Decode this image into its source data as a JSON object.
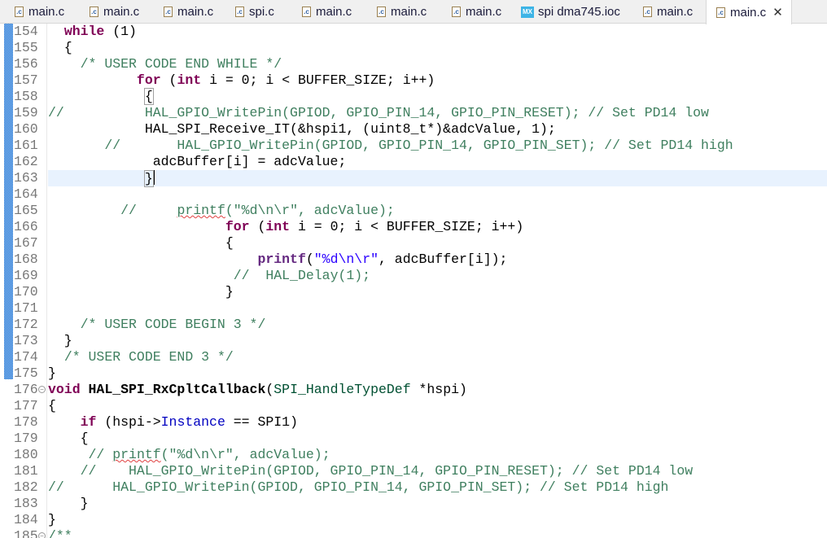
{
  "tabs": [
    {
      "label": "main.c",
      "icon": "c-file-icon"
    },
    {
      "label": "main.c",
      "icon": "c-file-icon"
    },
    {
      "label": "main.c",
      "icon": "c-file-icon"
    },
    {
      "label": "spi.c",
      "icon": "c-file-icon"
    },
    {
      "label": "main.c",
      "icon": "c-file-icon"
    },
    {
      "label": "main.c",
      "icon": "c-file-icon"
    },
    {
      "label": "main.c",
      "icon": "c-file-icon"
    },
    {
      "label": "spi dma745.ioc",
      "icon": "mx-icon"
    },
    {
      "label": "main.c",
      "icon": "c-file-icon"
    },
    {
      "label": "main.c",
      "icon": "c-file-icon",
      "active": true
    }
  ],
  "icons": {
    "c_file": ".c",
    "mx": "MX",
    "close": "✕",
    "fold": "−"
  },
  "code": {
    "current_line": 163,
    "lines": [
      {
        "n": "154",
        "segs": [
          [
            "p",
            "  "
          ],
          [
            "k",
            "while"
          ],
          [
            "p",
            " (1)"
          ]
        ]
      },
      {
        "n": "155",
        "segs": [
          [
            "p",
            "  {"
          ]
        ]
      },
      {
        "n": "156",
        "segs": [
          [
            "p",
            "    "
          ],
          [
            "c",
            "/* USER CODE END WHILE */"
          ]
        ]
      },
      {
        "n": "157",
        "segs": [
          [
            "p",
            "           "
          ],
          [
            "k",
            "for"
          ],
          [
            "p",
            " ("
          ],
          [
            "k",
            "int"
          ],
          [
            "p",
            " i = 0; i < BUFFER_SIZE; i++)"
          ]
        ]
      },
      {
        "n": "158",
        "segs": [
          [
            "p",
            "            "
          ],
          [
            "br",
            "{"
          ]
        ]
      },
      {
        "n": "159",
        "segs": [
          [
            "c",
            "//          HAL_GPIO_WritePin(GPIOD, GPIO_PIN_14, GPIO_PIN_RESET); // Set PD14 low"
          ]
        ]
      },
      {
        "n": "160",
        "segs": [
          [
            "p",
            "            HAL_SPI_Receive_IT(&hspi1, (uint8_t*)&adcValue, 1);"
          ]
        ]
      },
      {
        "n": "161",
        "segs": [
          [
            "p",
            "       "
          ],
          [
            "c",
            "//       HAL_GPIO_WritePin(GPIOD, GPIO_PIN_14, GPIO_PIN_SET); // Set PD14 high"
          ]
        ]
      },
      {
        "n": "162",
        "segs": [
          [
            "p",
            "             adcBuffer[i] = adcValue;"
          ]
        ]
      },
      {
        "n": "163",
        "segs": [
          [
            "p",
            "            "
          ],
          [
            "br",
            "}"
          ],
          [
            "caret",
            ""
          ]
        ]
      },
      {
        "n": "164",
        "segs": []
      },
      {
        "n": "165",
        "segs": [
          [
            "p",
            "         "
          ],
          [
            "c",
            "//     "
          ],
          [
            "csq",
            "printf"
          ],
          [
            "c",
            "(\"%d\\n\\r\", adcValue);"
          ]
        ]
      },
      {
        "n": "166",
        "segs": [
          [
            "p",
            "                      "
          ],
          [
            "k",
            "for"
          ],
          [
            "p",
            " ("
          ],
          [
            "k",
            "int"
          ],
          [
            "p",
            " i = 0; i < BUFFER_SIZE; i++)"
          ]
        ]
      },
      {
        "n": "167",
        "segs": [
          [
            "p",
            "                      {"
          ]
        ]
      },
      {
        "n": "168",
        "segs": [
          [
            "p",
            "                          "
          ],
          [
            "m",
            "printf"
          ],
          [
            "p",
            "("
          ],
          [
            "s",
            "\"%d\\n\\r\""
          ],
          [
            "p",
            ", adcBuffer[i]);"
          ]
        ]
      },
      {
        "n": "169",
        "segs": [
          [
            "p",
            "                       "
          ],
          [
            "c",
            "//  HAL_Delay(1);"
          ]
        ]
      },
      {
        "n": "170",
        "segs": [
          [
            "p",
            "                      }"
          ]
        ]
      },
      {
        "n": "171",
        "segs": []
      },
      {
        "n": "172",
        "segs": [
          [
            "p",
            "    "
          ],
          [
            "c",
            "/* USER CODE BEGIN 3 */"
          ]
        ]
      },
      {
        "n": "173",
        "segs": [
          [
            "p",
            "  }"
          ]
        ]
      },
      {
        "n": "174",
        "segs": [
          [
            "p",
            "  "
          ],
          [
            "c",
            "/* USER CODE END 3 */"
          ]
        ]
      },
      {
        "n": "175",
        "segs": [
          [
            "p",
            "}"
          ]
        ]
      },
      {
        "n": "176",
        "fold": true,
        "segs": [
          [
            "k",
            "void"
          ],
          [
            "p",
            " "
          ],
          [
            "f",
            "HAL_SPI_RxCpltCallback"
          ],
          [
            "p",
            "("
          ],
          [
            "t",
            "SPI_HandleTypeDef"
          ],
          [
            "p",
            " *hspi)"
          ]
        ]
      },
      {
        "n": "177",
        "segs": [
          [
            "p",
            "{"
          ]
        ]
      },
      {
        "n": "178",
        "segs": [
          [
            "p",
            "    "
          ],
          [
            "k",
            "if"
          ],
          [
            "p",
            " (hspi->"
          ],
          [
            "fld",
            "Instance"
          ],
          [
            "p",
            " == SPI1)"
          ]
        ]
      },
      {
        "n": "179",
        "segs": [
          [
            "p",
            "    {"
          ]
        ]
      },
      {
        "n": "180",
        "segs": [
          [
            "p",
            "     "
          ],
          [
            "c",
            "// "
          ],
          [
            "csq",
            "printf"
          ],
          [
            "c",
            "(\"%d\\n\\r\", adcValue);"
          ]
        ]
      },
      {
        "n": "181",
        "segs": [
          [
            "p",
            "    "
          ],
          [
            "c",
            "//    HAL_GPIO_WritePin(GPIOD, GPIO_PIN_14, GPIO_PIN_RESET); // Set PD14 low"
          ]
        ]
      },
      {
        "n": "182",
        "segs": [
          [
            "c",
            "//      HAL_GPIO_WritePin(GPIOD, GPIO_PIN_14, GPIO_PIN_SET); // Set PD14 high"
          ]
        ]
      },
      {
        "n": "183",
        "segs": [
          [
            "p",
            "    }"
          ]
        ]
      },
      {
        "n": "184",
        "segs": [
          [
            "p",
            "}"
          ]
        ]
      },
      {
        "n": "185",
        "fold": true,
        "segs": [
          [
            "c",
            "/**"
          ]
        ]
      }
    ]
  }
}
